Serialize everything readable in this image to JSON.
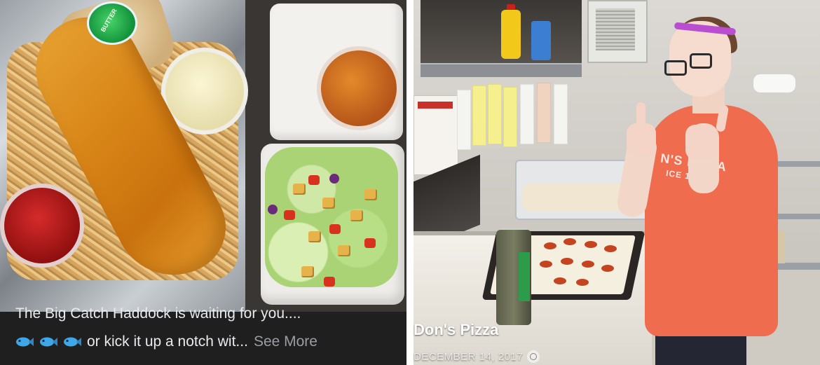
{
  "left_post": {
    "caption_line1": "The Big Catch Haddock is waiting for you....",
    "caption_line2_text": "or kick it up a notch wit...",
    "see_more": "See More",
    "emoji": [
      "fish-icon",
      "fish-icon",
      "fish-icon"
    ],
    "butter_label": "BUTTER"
  },
  "right_post": {
    "title": "Don's Pizza",
    "date": "DECEMBER 14, 2017",
    "privacy_icon": "globe-icon",
    "shirt_text": "N'S PIZZA",
    "shirt_subtext": "ICE 1994"
  }
}
